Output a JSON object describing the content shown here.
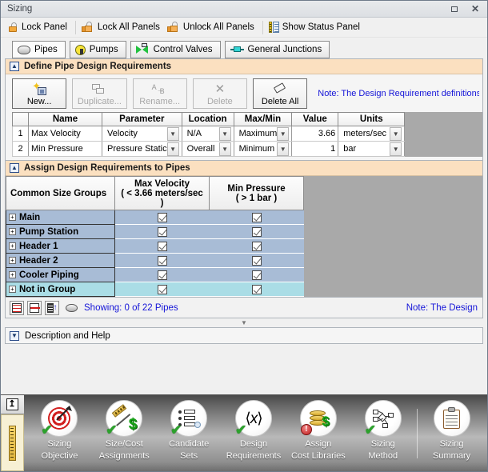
{
  "window": {
    "title": "Sizing",
    "maximize_label": "Maximize",
    "close_label": "Close"
  },
  "toolbar": {
    "items": [
      {
        "label": "Lock Panel",
        "icon": "lock-icon"
      },
      {
        "label": "Lock All Panels",
        "icon": "lock-all-icon"
      },
      {
        "label": "Unlock All Panels",
        "icon": "unlock-all-icon"
      },
      {
        "label": "Show Status Panel",
        "icon": "status-panel-icon"
      }
    ]
  },
  "tabs": [
    {
      "label": "Pipes",
      "icon": "pipe-icon",
      "active": true
    },
    {
      "label": "Pumps",
      "icon": "pump-icon",
      "active": false
    },
    {
      "label": "Control Valves",
      "icon": "control-valve-icon",
      "active": false
    },
    {
      "label": "General Junctions",
      "icon": "general-junction-icon",
      "active": false
    }
  ],
  "define_panel": {
    "title": "Define Pipe Design Requirements",
    "collapse_glyph": "▲",
    "buttons": [
      {
        "label": "New...",
        "enabled": true
      },
      {
        "label": "Duplicate...",
        "enabled": false
      },
      {
        "label": "Rename...",
        "enabled": false
      },
      {
        "label": "Delete",
        "enabled": false
      },
      {
        "label": "Delete All",
        "enabled": true
      }
    ],
    "note": "Note: The Design Requirement definitions",
    "grid": {
      "headers": [
        "",
        "Name",
        "Parameter",
        "Location",
        "Max/Min",
        "Value",
        "Units"
      ],
      "rows": [
        {
          "num": "1",
          "name": "Max Velocity",
          "parameter": "Velocity",
          "location": "N/A",
          "maxmin": "Maximum",
          "value": "3.66",
          "units": "meters/sec"
        },
        {
          "num": "2",
          "name": "Min Pressure",
          "parameter": "Pressure Static",
          "location": "Overall",
          "maxmin": "Minimum",
          "value": "1",
          "units": "bar"
        }
      ]
    }
  },
  "assign_panel": {
    "title": "Assign Design Requirements to Pipes",
    "collapse_glyph": "▲",
    "headers": {
      "group": "Common Size Groups",
      "columns": [
        {
          "name": "Max Velocity",
          "condition": "( < 3.66 meters/sec )"
        },
        {
          "name": "Min Pressure",
          "condition": "( > 1 bar )"
        }
      ]
    },
    "rows": [
      {
        "label": "Main",
        "checks": [
          true,
          true
        ],
        "highlight": false
      },
      {
        "label": "Pump Station",
        "checks": [
          true,
          true
        ],
        "highlight": false
      },
      {
        "label": "Header 1",
        "checks": [
          true,
          true
        ],
        "highlight": false
      },
      {
        "label": "Header 2",
        "checks": [
          true,
          true
        ],
        "highlight": false
      },
      {
        "label": "Cooler Piping",
        "checks": [
          true,
          true
        ],
        "highlight": false
      },
      {
        "label": "Not in Group",
        "checks": [
          true,
          true
        ],
        "highlight": true
      }
    ],
    "expander_glyph": "+"
  },
  "showbar": {
    "buttons": [
      {
        "name": "show-all-rows-icon"
      },
      {
        "name": "show-one-row-icon"
      },
      {
        "name": "sort-rows-icon"
      }
    ],
    "pipe_icon": "pipe-icon",
    "showing_text": "Showing: 0 of 22 Pipes",
    "note": "Note: The Design"
  },
  "splitter": {
    "glyph": "▼"
  },
  "description_bar": {
    "title": "Description and Help",
    "collapse_glyph": "▼"
  },
  "vertical_tab": {
    "pin_glyph": "↥",
    "icon": "ruler-icon"
  },
  "bottom_nav": {
    "items": [
      {
        "label_line1": "Sizing",
        "label_line2": "Objective",
        "icon": "target-arrow-icon",
        "status": "ok"
      },
      {
        "label_line1": "Size/Cost",
        "label_line2": "Assignments",
        "icon": "ruler-dollar-icon",
        "status": "ok"
      },
      {
        "label_line1": "Candidate",
        "label_line2": "Sets",
        "icon": "list-search-icon",
        "status": "ok"
      },
      {
        "label_line1": "Design",
        "label_line2": "Requirements",
        "icon": "variable-brackets-icon",
        "status": "ok"
      },
      {
        "label_line1": "Assign",
        "label_line2": "Cost Libraries",
        "icon": "coins-dollar-icon",
        "status": "error"
      },
      {
        "label_line1": "Sizing",
        "label_line2": "Method",
        "icon": "network-diagram-icon",
        "status": "ok"
      },
      {
        "label_line1": "Sizing",
        "label_line2": "Summary",
        "icon": "clipboard-icon",
        "status": "none"
      }
    ],
    "ok_glyph": "✔",
    "error_glyph": "!"
  }
}
